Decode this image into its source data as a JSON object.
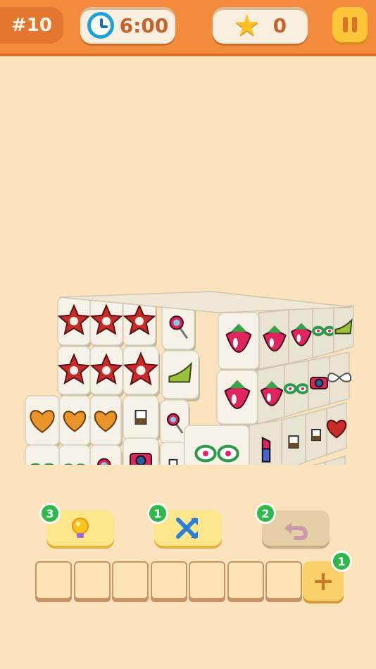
{
  "hud": {
    "level": "#10",
    "timer": "6:00",
    "stars": "0"
  },
  "icons": {
    "clock": "clock-icon",
    "star": "star-icon",
    "pause": "pause-icon",
    "hint": "lightbulb-icon",
    "shuffle": "shuffle-icon",
    "undo": "undo-icon",
    "add": "plus-icon"
  },
  "tools": {
    "hint_count": "3",
    "shuffle_count": "1",
    "undo_count": "2",
    "add_slot_count": "1"
  },
  "tray": {
    "slot_count": 7
  },
  "colors": {
    "top_bar": "#f28b3c",
    "background": "#fbe3bd",
    "badge": "#2fb84c",
    "tile_face": "#f6f2e8"
  }
}
